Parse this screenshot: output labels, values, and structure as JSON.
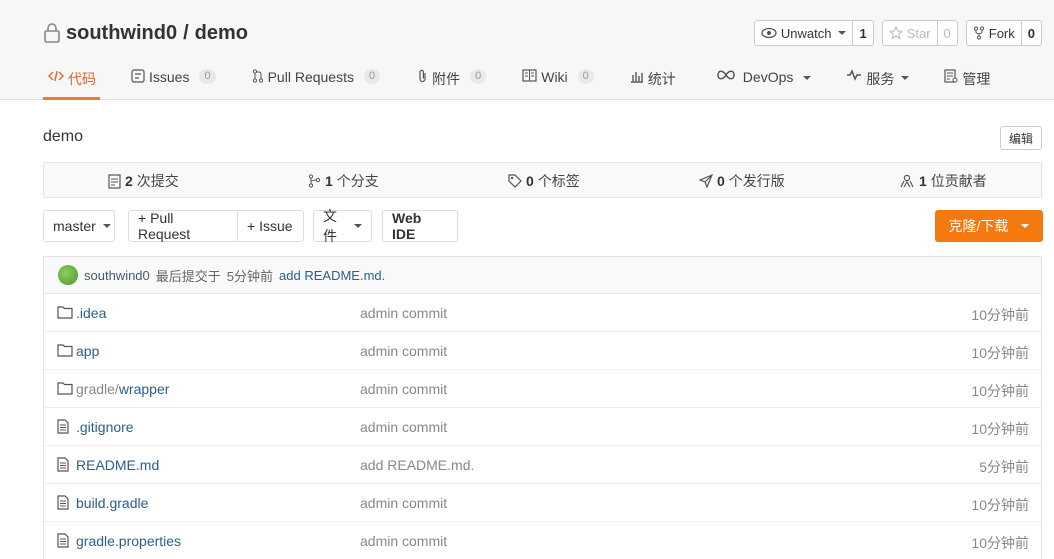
{
  "repo": {
    "owner": "southwind0",
    "separator": "/",
    "name": "demo"
  },
  "actions": {
    "unwatch": {
      "label": "Unwatch",
      "count": "1"
    },
    "star": {
      "label": "Star",
      "count": "0"
    },
    "fork": {
      "label": "Fork",
      "count": "0"
    }
  },
  "tabs": [
    {
      "label": "代码",
      "icon": "code-icon"
    },
    {
      "label": "Issues",
      "badge": "0",
      "icon": "issues-icon"
    },
    {
      "label": "Pull Requests",
      "badge": "0",
      "icon": "pull-request-icon"
    },
    {
      "label": "附件",
      "badge": "0",
      "icon": "attachment-icon"
    },
    {
      "label": "Wiki",
      "badge": "0",
      "icon": "wiki-icon"
    },
    {
      "label": "统计",
      "icon": "stats-icon"
    },
    {
      "label": "DevOps",
      "icon": "devops-icon"
    },
    {
      "label": "服务",
      "icon": "service-icon"
    },
    {
      "label": "管理",
      "icon": "manage-icon"
    }
  ],
  "description": "demo",
  "edit_label": "编辑",
  "stats": [
    {
      "count": "2",
      "label": "次提交",
      "icon": "commit-icon"
    },
    {
      "count": "1",
      "label": "个分支",
      "icon": "branch-icon"
    },
    {
      "count": "0",
      "label": "个标签",
      "icon": "tag-icon"
    },
    {
      "count": "0",
      "label": "个发行版",
      "icon": "release-icon"
    },
    {
      "count": "1",
      "label": "位贡献者",
      "icon": "contributors-icon"
    }
  ],
  "toolbar": {
    "branch": "master",
    "pull_request": "+ Pull Request",
    "issue": "+ Issue",
    "files": "文件",
    "web_ide": "Web IDE",
    "clone": "克隆/下载"
  },
  "last_commit": {
    "user": "southwind0",
    "text": "最后提交于",
    "time": "5分钟前",
    "message": "add README.md."
  },
  "files": [
    {
      "type": "folder",
      "name": ".idea",
      "prefix": "",
      "commit": "admin commit",
      "time": "10分钟前"
    },
    {
      "type": "folder",
      "name": "app",
      "prefix": "",
      "commit": "admin commit",
      "time": "10分钟前"
    },
    {
      "type": "folder",
      "name": "wrapper",
      "prefix": "gradle/",
      "commit": "admin commit",
      "time": "10分钟前"
    },
    {
      "type": "file",
      "name": ".gitignore",
      "prefix": "",
      "commit": "admin commit",
      "time": "10分钟前"
    },
    {
      "type": "file",
      "name": "README.md",
      "prefix": "",
      "commit": "add README.md.",
      "time": "5分钟前"
    },
    {
      "type": "file",
      "name": "build.gradle",
      "prefix": "",
      "commit": "admin commit",
      "time": "10分钟前"
    },
    {
      "type": "file",
      "name": "gradle.properties",
      "prefix": "",
      "commit": "admin commit",
      "time": "10分钟前"
    }
  ],
  "colors": {
    "accent": "#f07b2f",
    "clone_bg": "#f4790f",
    "link": "#2b5e8b"
  }
}
